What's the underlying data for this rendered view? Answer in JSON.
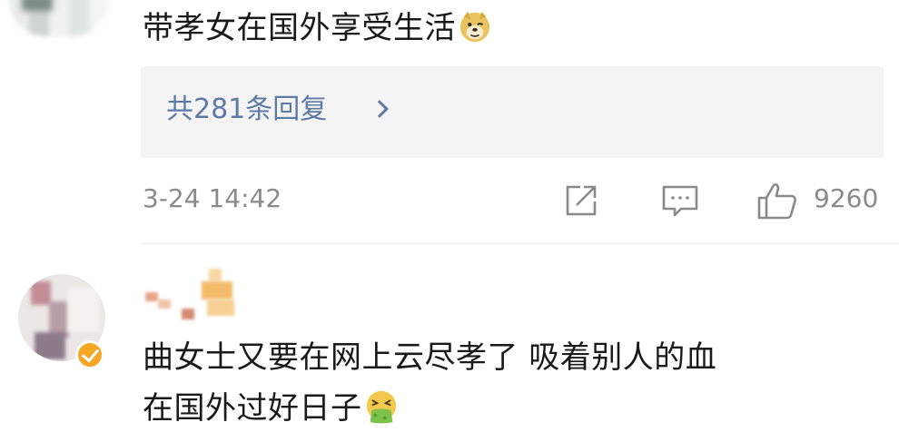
{
  "comment1": {
    "text": "带孝女在国外享受生活",
    "emoji_icon": "doge-emoji-icon",
    "reply_summary": "共281条回复",
    "timestamp": "3-24 14:42",
    "like_count": "9260"
  },
  "comment2": {
    "line1": "曲女士又要在网上云尽孝了 吸着别人的血",
    "line2": "在国外过好日子",
    "emoji_icon": "vomiting-face-emoji-icon"
  },
  "colors": {
    "link": "#5b7aa6",
    "meta": "#8a8a8a",
    "verified": "#f5a623",
    "reply_bg": "#f4f4f4"
  }
}
